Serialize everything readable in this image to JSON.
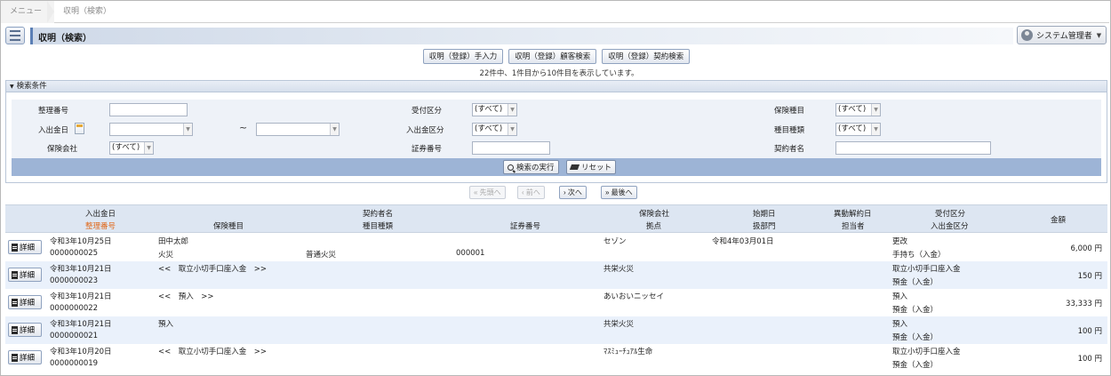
{
  "breadcrumb": [
    "メニュー",
    "収明（検索）"
  ],
  "page_title": "収明（検索）",
  "user": {
    "name": "システム管理者"
  },
  "top_buttons": [
    "収明（登録）手入力",
    "収明（登録）顧客検索",
    "収明（登録）契約検索"
  ],
  "count_text": "22件中、1件目から10件目を表示しています。",
  "search": {
    "section_title": "検索条件",
    "labels": {
      "seiri": "整理番号",
      "nyushukkin_date": "入出金日",
      "hoken_kaisha": "保険会社",
      "uketsuke": "受付区分",
      "nyushukkin_kubun": "入出金区分",
      "shoken": "証券番号",
      "hoken_shumoku": "保険種目",
      "shumoku_shurui": "種目種類",
      "keiyakusha": "契約者名"
    },
    "select_all": "(すべて)",
    "tilde": "~",
    "execute_label": "検索の実行",
    "reset_label": "リセット"
  },
  "pager": {
    "first": "«  先頭へ",
    "prev": "‹  前へ",
    "next": "›  次へ",
    "last": "»  最後へ"
  },
  "columns": {
    "h1a": "入出金日",
    "h1b": "整理番号",
    "h2": "保険種目",
    "h3a": "契約者名",
    "h3b": "種目種類",
    "h4": "証券番号",
    "h5a": "保険会社",
    "h5b": "拠点",
    "h6a": "始期日",
    "h6b": "扱部門",
    "h7a": "異動解約日",
    "h7b": "担当者",
    "h8a": "受付区分",
    "h8b": "入出金区分",
    "h9": "金額"
  },
  "detail_label": "詳細",
  "rows": [
    {
      "date": "令和3年10月25日",
      "seiri": "0000000025",
      "keiyakusha": "田中太郎",
      "hoken_shumoku": "火災",
      "shumoku_shurui": "普通火災",
      "shoken": "000001",
      "kaisha": "セゾン",
      "shiki": "令和4年03月01日",
      "uketsuke": "更改",
      "kubun": "手持ち（入金）",
      "amount": "6,000 円"
    },
    {
      "date": "令和3年10月21日",
      "seiri": "0000000023",
      "keiyakusha": "<<　取立小切手口座入金　>>",
      "hoken_shumoku": "",
      "shumoku_shurui": "",
      "shoken": "",
      "kaisha": "共栄火災",
      "shiki": "",
      "uketsuke": "取立小切手口座入金",
      "kubun": "預金（入金）",
      "amount": "150 円"
    },
    {
      "date": "令和3年10月21日",
      "seiri": "0000000022",
      "keiyakusha": "<<　預入　>>",
      "hoken_shumoku": "",
      "shumoku_shurui": "",
      "shoken": "",
      "kaisha": "あいおいニッセイ",
      "shiki": "",
      "uketsuke": "預入",
      "kubun": "預金（入金）",
      "amount": "33,333 円"
    },
    {
      "date": "令和3年10月21日",
      "seiri": "0000000021",
      "keiyakusha": "預入",
      "hoken_shumoku": "",
      "shumoku_shurui": "",
      "shoken": "",
      "kaisha": "共栄火災",
      "shiki": "",
      "uketsuke": "預入",
      "kubun": "預金（入金）",
      "amount": "100 円"
    },
    {
      "date": "令和3年10月20日",
      "seiri": "0000000019",
      "keiyakusha": "<<　取立小切手口座入金　>>",
      "hoken_shumoku": "",
      "shumoku_shurui": "",
      "shoken": "",
      "kaisha": "ﾏｽﾐｭｰﾁｭｱﾙ生命",
      "shiki": "",
      "uketsuke": "取立小切手口座入金",
      "kubun": "預金（入金）",
      "amount": "100 円"
    }
  ]
}
